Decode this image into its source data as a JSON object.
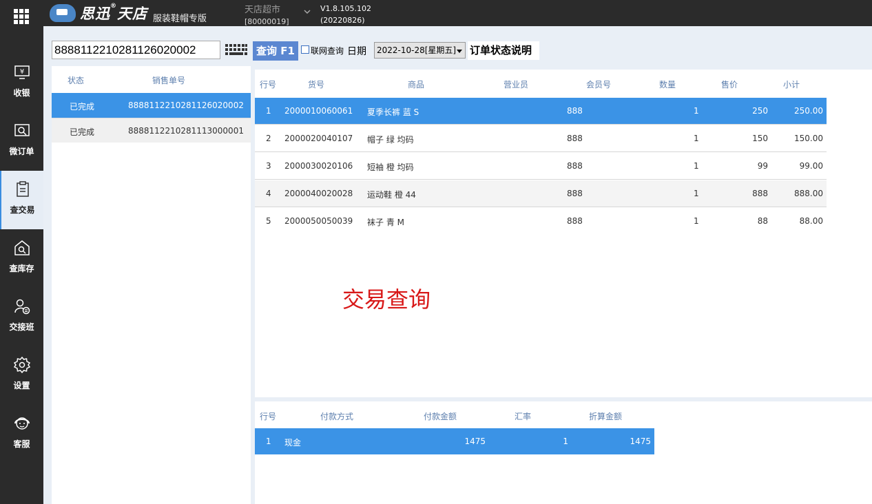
{
  "topbar": {
    "logo_brand": "思迅",
    "logo_reg": "®",
    "logo_product": "天店",
    "logo_edition": "服装鞋帽专版",
    "store_name": "天店超市",
    "store_code": "[80000019]",
    "version": "V1.8.105.102",
    "build": "(20220826)"
  },
  "sidebar": {
    "items": [
      {
        "label": "收银",
        "icon": "yuan-screen-icon"
      },
      {
        "label": "微订单",
        "icon": "order-search-icon"
      },
      {
        "label": "查交易",
        "icon": "clipboard-icon"
      },
      {
        "label": "查库存",
        "icon": "warehouse-search-icon"
      },
      {
        "label": "交接班",
        "icon": "shift-handover-icon"
      },
      {
        "label": "设置",
        "icon": "gear-icon"
      },
      {
        "label": "客服",
        "icon": "support-headset-icon"
      }
    ],
    "active_index": 2
  },
  "search": {
    "value": "8888112210281126020002",
    "query_button": "查询 F1",
    "net_query_label": "联网查询",
    "net_query_checked": false,
    "date_label": "日期",
    "date_value": "2022-10-28[星期五]",
    "status_help": "订单状态说明"
  },
  "orders": {
    "headers": [
      "状态",
      "销售单号"
    ],
    "rows": [
      {
        "status": "已完成",
        "no": "8888112210281126020002",
        "selected": true
      },
      {
        "status": "已完成",
        "no": "8888112210281113000001",
        "selected": false
      }
    ]
  },
  "items": {
    "headers": [
      "行号",
      "货号",
      "商品",
      "营业员",
      "会员号",
      "数量",
      "售价",
      "小计"
    ],
    "rows": [
      {
        "line": "1",
        "code": "2000010060061",
        "name": "夏季长裤 蓝 S",
        "clerk": "888",
        "member": "",
        "qty": "1",
        "price": "250",
        "subtotal": "250.00"
      },
      {
        "line": "2",
        "code": "2000020040107",
        "name": "帽子 绿 均码",
        "clerk": "888",
        "member": "",
        "qty": "1",
        "price": "150",
        "subtotal": "150.00"
      },
      {
        "line": "3",
        "code": "2000030020106",
        "name": "短袖 橙 均码",
        "clerk": "888",
        "member": "",
        "qty": "1",
        "price": "99",
        "subtotal": "99.00"
      },
      {
        "line": "4",
        "code": "2000040020028",
        "name": "运动鞋 橙 44",
        "clerk": "888",
        "member": "",
        "qty": "1",
        "price": "888",
        "subtotal": "888.00"
      },
      {
        "line": "5",
        "code": "2000050050039",
        "name": "袜子 青 M",
        "clerk": "888",
        "member": "",
        "qty": "1",
        "price": "88",
        "subtotal": "88.00"
      }
    ]
  },
  "overlay_title": "交易查询",
  "payments": {
    "headers": [
      "行号",
      "付款方式",
      "付款金额",
      "汇率",
      "折算金额"
    ],
    "rows": [
      {
        "line": "1",
        "method": "现金",
        "amount": "1475",
        "rate": "1",
        "converted": "1475"
      }
    ]
  },
  "colors": {
    "accent": "#3b93e6",
    "button": "#5b87d1",
    "header_text": "#5d7fae",
    "sidebar_bg": "#2b2b2b",
    "overlay_red": "#d81818"
  }
}
